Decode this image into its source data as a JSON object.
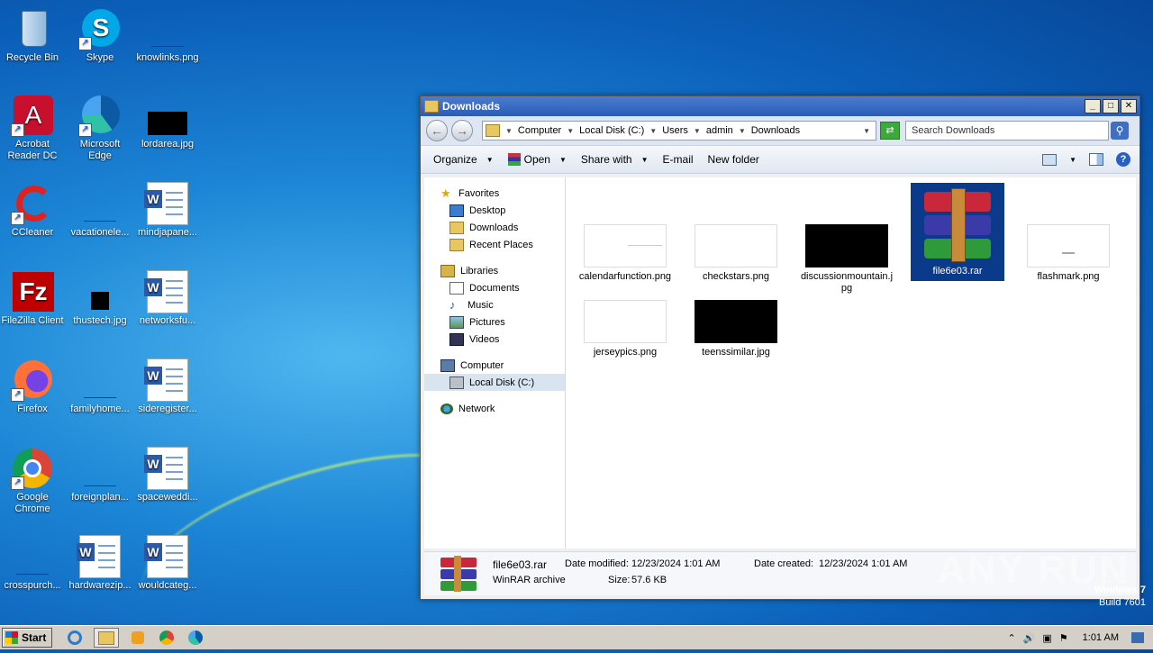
{
  "desktop": {
    "icons": [
      {
        "label": "Recycle Bin"
      },
      {
        "label": "Skype"
      },
      {
        "label": "knowlinks.png"
      },
      {
        "label": "Acrobat Reader DC"
      },
      {
        "label": "Microsoft Edge"
      },
      {
        "label": "lordarea.jpg"
      },
      {
        "label": "CCleaner"
      },
      {
        "label": "vacationele..."
      },
      {
        "label": "mindjapane..."
      },
      {
        "label": "FileZilla Client"
      },
      {
        "label": "thustech.jpg"
      },
      {
        "label": "networksfu..."
      },
      {
        "label": "Firefox"
      },
      {
        "label": "familyhome..."
      },
      {
        "label": "sideregister..."
      },
      {
        "label": "Google Chrome"
      },
      {
        "label": "foreignplan..."
      },
      {
        "label": "spaceweddi..."
      },
      {
        "label": "crosspurch..."
      },
      {
        "label": "hardwarezip..."
      },
      {
        "label": "wouldcateg..."
      }
    ]
  },
  "window": {
    "title": "Downloads",
    "caption_buttons": {
      "minimize": "_",
      "maximize": "□",
      "close": "✕"
    },
    "breadcrumb": [
      "Computer",
      "Local Disk (C:)",
      "Users",
      "admin",
      "Downloads"
    ],
    "search_placeholder": "Search Downloads",
    "toolbar": {
      "organize": "Organize",
      "open": "Open",
      "share": "Share with",
      "email": "E-mail",
      "new_folder": "New folder"
    },
    "nav": {
      "favorites": "Favorites",
      "desktop": "Desktop",
      "downloads": "Downloads",
      "recent": "Recent Places",
      "libraries": "Libraries",
      "documents": "Documents",
      "music": "Music",
      "pictures": "Pictures",
      "videos": "Videos",
      "computer": "Computer",
      "local_disk": "Local Disk (C:)",
      "network": "Network"
    },
    "files": [
      {
        "name": "calendarfunction.png"
      },
      {
        "name": "checkstars.png"
      },
      {
        "name": "discussionmountain.jpg"
      },
      {
        "name": "file6e03.rar"
      },
      {
        "name": "flashmark.png"
      },
      {
        "name": "jerseypics.png"
      },
      {
        "name": "teenssimilar.jpg"
      }
    ],
    "status": {
      "filename": "file6e03.rar",
      "type": "WinRAR archive",
      "date_modified_label": "Date modified:",
      "date_modified": "12/23/2024 1:01 AM",
      "date_created_label": "Date created:",
      "date_created": "12/23/2024 1:01 AM",
      "size_label": "Size:",
      "size": "57.6 KB"
    }
  },
  "watermark": {
    "brand": "ANY RUN",
    "os": "Windows 7",
    "build": "Build 7601"
  },
  "taskbar": {
    "start": "Start",
    "clock": "1:01 AM"
  }
}
